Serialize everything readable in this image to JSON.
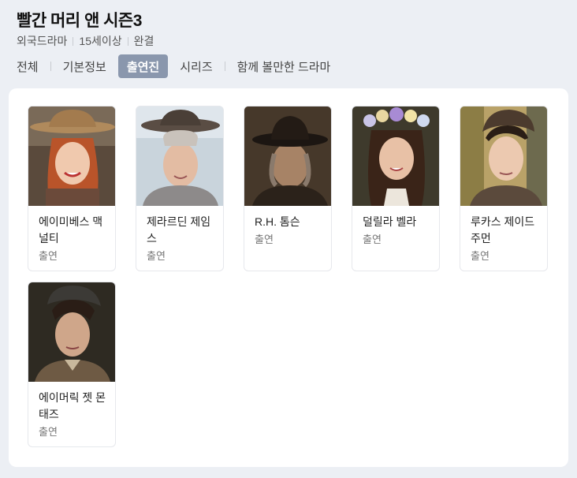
{
  "header": {
    "title": "빨간 머리 앤 시즌3",
    "meta": [
      "외국드라마",
      "15세이상",
      "완결"
    ]
  },
  "tabs": [
    {
      "label": "전체",
      "active": false
    },
    {
      "label": "기본정보",
      "active": false
    },
    {
      "label": "출연진",
      "active": true
    },
    {
      "label": "시리즈",
      "active": false
    },
    {
      "label": "함께 볼만한 드라마",
      "active": false
    }
  ],
  "cast": [
    {
      "name": "에이미베스 맥널티",
      "role": "출연"
    },
    {
      "name": "제라르딘 제임스",
      "role": "출연"
    },
    {
      "name": "R.H. 톰슨",
      "role": "출연"
    },
    {
      "name": "덜릴라 벨라",
      "role": "출연"
    },
    {
      "name": "루카스 제이드 주먼",
      "role": "출연"
    },
    {
      "name": "에이머릭 젯 몬태즈",
      "role": "출연"
    }
  ]
}
